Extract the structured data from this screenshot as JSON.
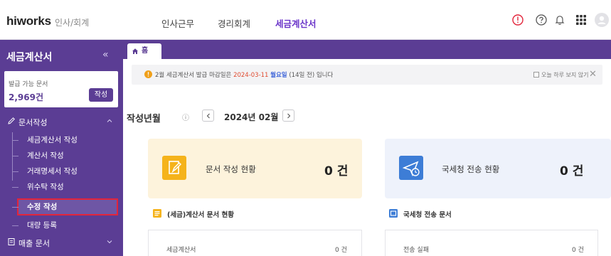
{
  "header": {
    "logo": "hiworks",
    "logo_sub": "인사/회계",
    "menu": [
      {
        "label": "인사근무"
      },
      {
        "label": "경리회계"
      },
      {
        "label": "세금계산서"
      }
    ],
    "icons": [
      "alert-circle-icon",
      "help-circle-icon",
      "bell-icon",
      "apps-grid-icon",
      "user-avatar-icon"
    ],
    "accent_color": "#6a34c9",
    "alert_color": "#e2253b"
  },
  "sidebar": {
    "title": "세금계산서",
    "collapse_symbol": "«",
    "card": {
      "label": "발급 가능 문서",
      "count": "2,969건",
      "button": "작성"
    },
    "section_write": "문서작성",
    "items": [
      {
        "label": "세금계산서 작성"
      },
      {
        "label": "계산서 작성"
      },
      {
        "label": "거래명세서 작성"
      },
      {
        "label": "위수탁 작성"
      },
      {
        "label": "수정 작성"
      },
      {
        "label": "대량 등록"
      }
    ],
    "section_sales": "매출 문서",
    "background_color": "#5b3d94"
  },
  "tabs": {
    "home": "홈"
  },
  "notice": {
    "prefix": "2월 세금계산서 발급 마감일은 ",
    "date": "2024-03-11",
    "weekday": "월요일",
    "suffix": " (14일 전) 입니다",
    "checkbox_label": "오늘 하루 보지 않기",
    "close_symbol": "✕"
  },
  "period": {
    "label": "작성년월",
    "info_symbol": "ⓘ",
    "value": "2024년 02월"
  },
  "stats": [
    {
      "label": "문서 작성 현황",
      "value": "0 건",
      "color": "#fdf3dc",
      "icon_color": "#f5b31b"
    },
    {
      "label": "국세청 전송 현황",
      "value": "0 건",
      "color": "#eef2fb",
      "icon_color": "#3d7dd6"
    }
  ],
  "lists": [
    {
      "title": "(세금)계산서 문서 현황",
      "row_label": "세금계산서",
      "row_value": "0 건"
    },
    {
      "title": "국세청 전송 문서",
      "row_label": "전송 실패",
      "row_value": "0 건"
    }
  ]
}
